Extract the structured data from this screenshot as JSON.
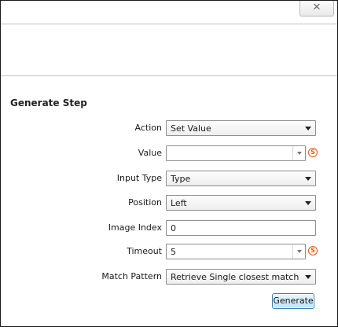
{
  "window": {
    "close_label": "✕"
  },
  "section_title": "Generate Step",
  "fields": {
    "action": {
      "label": "Action",
      "value": "Set Value"
    },
    "value": {
      "label": "Value",
      "value": "",
      "var_icon": "S"
    },
    "input_type": {
      "label": "Input Type",
      "value": "Type"
    },
    "position": {
      "label": "Position",
      "value": "Left"
    },
    "image_index": {
      "label": "Image Index",
      "value": "0"
    },
    "timeout": {
      "label": "Timeout",
      "value": "5",
      "var_icon": "S"
    },
    "match_pattern": {
      "label": "Match Pattern",
      "value": "Retrieve Single closest match"
    }
  },
  "generate_label": "Generate",
  "icons": {
    "close": "close-icon",
    "dropdown": "chevron-down-icon",
    "variable": "variable-icon"
  },
  "colors": {
    "accent_variable": "#e8590c",
    "button_border": "#3c7fb1"
  }
}
